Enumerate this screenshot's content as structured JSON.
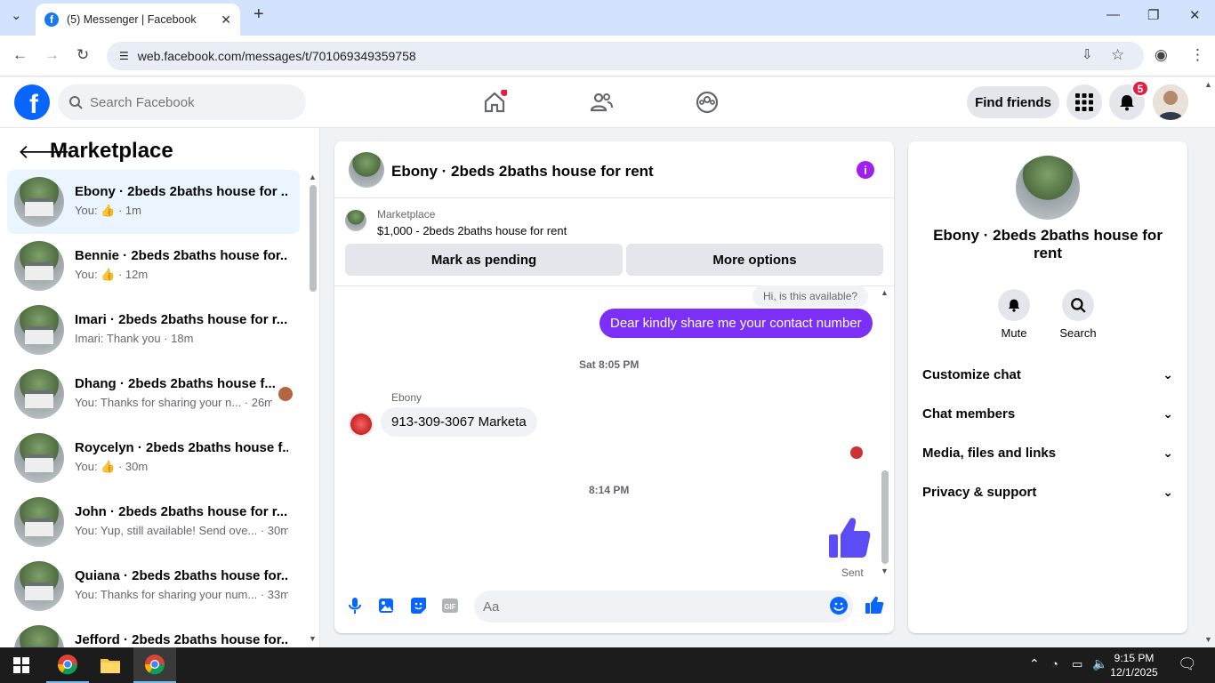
{
  "browser": {
    "tab_title": "(5) Messenger | Facebook",
    "favicon_letter": "f",
    "tab_close": "✕",
    "new_tab": "+",
    "url": "web.facebook.com/messages/t/701069349359758"
  },
  "fb_header": {
    "search_placeholder": "Search Facebook",
    "find_friends": "Find friends",
    "notification_count": "5"
  },
  "left": {
    "title": "Marketplace",
    "conversations": [
      {
        "name": "Ebony · 2beds 2baths house for ...",
        "preview": "You: 👍 · 1m"
      },
      {
        "name": "Bennie · 2beds 2baths house for...",
        "preview": "You: 👍 · 12m"
      },
      {
        "name": "Imari · 2beds 2baths house for r...",
        "preview": "Imari: Thank you · 18m"
      },
      {
        "name": "Dhang · 2beds 2baths house f...",
        "preview": "You: Thanks for sharing your n... · 26m"
      },
      {
        "name": "Roycelyn · 2beds 2baths house f...",
        "preview": "You: 👍 · 30m"
      },
      {
        "name": "John · 2beds 2baths house for r...",
        "preview": "You: Yup, still available! Send ove... · 30m"
      },
      {
        "name": "Quiana · 2beds 2baths house for...",
        "preview": "You: Thanks for sharing your num... · 33m"
      },
      {
        "name": "Jefford · 2beds 2baths house for...",
        "preview": ""
      }
    ]
  },
  "chat": {
    "title": "Ebony · 2beds 2baths house for rent",
    "listing_source": "Marketplace",
    "listing_price": "$1,000 - 2beds 2baths house for rent",
    "mark_pending": "Mark as pending",
    "more_options": "More options",
    "messages": {
      "top_partial": "Hi, is this available?",
      "outgoing": "Dear kindly share me your contact number",
      "time1": "Sat 8:05 PM",
      "sender": "Ebony",
      "incoming": "913-309-3067 Marketa",
      "time2": "8:14 PM",
      "sent_status": "Sent"
    },
    "input_placeholder": "Aa"
  },
  "right": {
    "name": "Ebony · 2beds 2baths house for rent",
    "mute": "Mute",
    "search": "Search",
    "sections": [
      "Customize chat",
      "Chat members",
      "Media, files and links",
      "Privacy & support"
    ]
  },
  "taskbar": {
    "time": "9:15 PM",
    "date": "12/1/2025"
  },
  "colors": {
    "accent": "#0866ff",
    "bubble_out": "#7b2ff7",
    "active_row": "#ebf5ff"
  }
}
